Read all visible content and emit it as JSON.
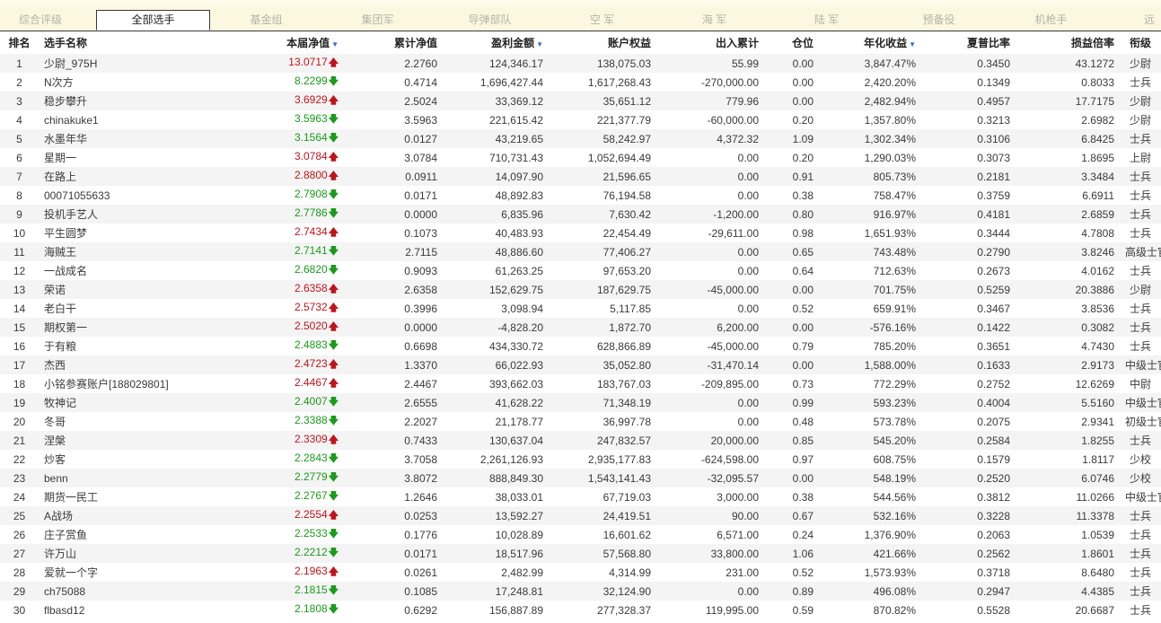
{
  "tabs": [
    {
      "label": "综合评级"
    },
    {
      "label": "全部选手"
    },
    {
      "label": "基金组"
    },
    {
      "label": "集团军"
    },
    {
      "label": "导弹部队"
    },
    {
      "label": "空 军"
    },
    {
      "label": "海 军"
    },
    {
      "label": "陆 军"
    },
    {
      "label": "预备役"
    },
    {
      "label": "机枪手"
    },
    {
      "label": "远"
    }
  ],
  "active_tab": "全部选手",
  "columns": {
    "rank": "排名",
    "name": "选手名称",
    "nav": "本届净值",
    "cum": "累计净值",
    "profit": "盈利金额",
    "equity": "账户权益",
    "inout": "出入累计",
    "pos": "仓位",
    "annual": "年化收益",
    "sharpe": "夏普比率",
    "ratio": "损益倍率",
    "title": "衔级"
  },
  "sort_indicator": "▼",
  "arrows": {
    "up": "🡅",
    "down": "🡇"
  },
  "colors": {
    "up": "#c0141d",
    "down": "#1b9a1b",
    "tab_bg": "#fcf8df",
    "row_alt": "#f4f4f4"
  },
  "rows": [
    {
      "rank": "1",
      "name": "少尉_975H",
      "nav": "13.0717",
      "dir": "up",
      "cum": "2.2760",
      "profit": "124,346.17",
      "equity": "138,075.03",
      "inout": "55.99",
      "pos": "0.00",
      "annual": "3,847.47%",
      "sharpe": "0.3450",
      "ratio": "43.1272",
      "title": "少尉"
    },
    {
      "rank": "2",
      "name": "N次方",
      "nav": "8.2299",
      "dir": "down",
      "cum": "0.4714",
      "profit": "1,696,427.44",
      "equity": "1,617,268.43",
      "inout": "-270,000.00",
      "pos": "0.00",
      "annual": "2,420.20%",
      "sharpe": "0.1349",
      "ratio": "0.8033",
      "title": "士兵"
    },
    {
      "rank": "3",
      "name": "稳步攀升",
      "nav": "3.6929",
      "dir": "up",
      "cum": "2.5024",
      "profit": "33,369.12",
      "equity": "35,651.12",
      "inout": "779.96",
      "pos": "0.00",
      "annual": "2,482.94%",
      "sharpe": "0.4957",
      "ratio": "17.7175",
      "title": "少尉"
    },
    {
      "rank": "4",
      "name": "chinakuke1",
      "nav": "3.5963",
      "dir": "down",
      "cum": "3.5963",
      "profit": "221,615.42",
      "equity": "221,377.79",
      "inout": "-60,000.00",
      "pos": "0.20",
      "annual": "1,357.80%",
      "sharpe": "0.3213",
      "ratio": "2.6982",
      "title": "少尉"
    },
    {
      "rank": "5",
      "name": "水墨年华",
      "nav": "3.1564",
      "dir": "down",
      "cum": "0.0127",
      "profit": "43,219.65",
      "equity": "58,242.97",
      "inout": "4,372.32",
      "pos": "1.09",
      "annual": "1,302.34%",
      "sharpe": "0.3106",
      "ratio": "6.8425",
      "title": "士兵"
    },
    {
      "rank": "6",
      "name": "星期一",
      "nav": "3.0784",
      "dir": "up",
      "cum": "3.0784",
      "profit": "710,731.43",
      "equity": "1,052,694.49",
      "inout": "0.00",
      "pos": "0.20",
      "annual": "1,290.03%",
      "sharpe": "0.3073",
      "ratio": "1.8695",
      "title": "上尉"
    },
    {
      "rank": "7",
      "name": "在路上",
      "nav": "2.8800",
      "dir": "up",
      "cum": "0.0911",
      "profit": "14,097.90",
      "equity": "21,596.65",
      "inout": "0.00",
      "pos": "0.91",
      "annual": "805.73%",
      "sharpe": "0.2181",
      "ratio": "3.3484",
      "title": "士兵"
    },
    {
      "rank": "8",
      "name": "00071055633",
      "nav": "2.7908",
      "dir": "down",
      "cum": "0.0171",
      "profit": "48,892.83",
      "equity": "76,194.58",
      "inout": "0.00",
      "pos": "0.38",
      "annual": "758.47%",
      "sharpe": "0.3759",
      "ratio": "6.6911",
      "title": "士兵"
    },
    {
      "rank": "9",
      "name": "投机手艺人",
      "nav": "2.7786",
      "dir": "down",
      "cum": "0.0000",
      "profit": "6,835.96",
      "equity": "7,630.42",
      "inout": "-1,200.00",
      "pos": "0.80",
      "annual": "916.97%",
      "sharpe": "0.4181",
      "ratio": "2.6859",
      "title": "士兵"
    },
    {
      "rank": "10",
      "name": "平生圆梦",
      "nav": "2.7434",
      "dir": "up",
      "cum": "0.1073",
      "profit": "40,483.93",
      "equity": "22,454.49",
      "inout": "-29,611.00",
      "pos": "0.98",
      "annual": "1,651.93%",
      "sharpe": "0.3444",
      "ratio": "4.7808",
      "title": "士兵"
    },
    {
      "rank": "11",
      "name": "海贼王",
      "nav": "2.7141",
      "dir": "down",
      "cum": "2.7115",
      "profit": "48,886.60",
      "equity": "77,406.27",
      "inout": "0.00",
      "pos": "0.65",
      "annual": "743.48%",
      "sharpe": "0.2790",
      "ratio": "3.8246",
      "title": "高级士官"
    },
    {
      "rank": "12",
      "name": "一战成名",
      "nav": "2.6820",
      "dir": "down",
      "cum": "0.9093",
      "profit": "61,263.25",
      "equity": "97,653.20",
      "inout": "0.00",
      "pos": "0.64",
      "annual": "712.63%",
      "sharpe": "0.2673",
      "ratio": "4.0162",
      "title": "士兵"
    },
    {
      "rank": "13",
      "name": "荣诺",
      "nav": "2.6358",
      "dir": "up",
      "cum": "2.6358",
      "profit": "152,629.75",
      "equity": "187,629.75",
      "inout": "-45,000.00",
      "pos": "0.00",
      "annual": "701.75%",
      "sharpe": "0.5259",
      "ratio": "20.3886",
      "title": "少尉"
    },
    {
      "rank": "14",
      "name": "老白干",
      "nav": "2.5732",
      "dir": "up",
      "cum": "0.3996",
      "profit": "3,098.94",
      "equity": "5,117.85",
      "inout": "0.00",
      "pos": "0.52",
      "annual": "659.91%",
      "sharpe": "0.3467",
      "ratio": "3.8536",
      "title": "士兵"
    },
    {
      "rank": "15",
      "name": "期权第一",
      "nav": "2.5020",
      "dir": "up",
      "cum": "0.0000",
      "profit": "-4,828.20",
      "equity": "1,872.70",
      "inout": "6,200.00",
      "pos": "0.00",
      "annual": "-576.16%",
      "sharpe": "0.1422",
      "ratio": "0.3082",
      "title": "士兵"
    },
    {
      "rank": "16",
      "name": "于有粮",
      "nav": "2.4883",
      "dir": "down",
      "cum": "0.6698",
      "profit": "434,330.72",
      "equity": "628,866.89",
      "inout": "-45,000.00",
      "pos": "0.79",
      "annual": "785.20%",
      "sharpe": "0.3651",
      "ratio": "4.7430",
      "title": "士兵"
    },
    {
      "rank": "17",
      "name": "杰西",
      "nav": "2.4723",
      "dir": "up",
      "cum": "1.3370",
      "profit": "66,022.93",
      "equity": "35,052.80",
      "inout": "-31,470.14",
      "pos": "0.00",
      "annual": "1,588.00%",
      "sharpe": "0.1633",
      "ratio": "2.9173",
      "title": "中级士官"
    },
    {
      "rank": "18",
      "name": "小铭参赛账户[188029801]",
      "nav": "2.4467",
      "dir": "up",
      "cum": "2.4467",
      "profit": "393,662.03",
      "equity": "183,767.03",
      "inout": "-209,895.00",
      "pos": "0.73",
      "annual": "772.29%",
      "sharpe": "0.2752",
      "ratio": "12.6269",
      "title": "中尉"
    },
    {
      "rank": "19",
      "name": "牧神记",
      "nav": "2.4007",
      "dir": "down",
      "cum": "2.6555",
      "profit": "41,628.22",
      "equity": "71,348.19",
      "inout": "0.00",
      "pos": "0.99",
      "annual": "593.23%",
      "sharpe": "0.4004",
      "ratio": "5.5160",
      "title": "中级士官"
    },
    {
      "rank": "20",
      "name": "冬哥",
      "nav": "2.3388",
      "dir": "down",
      "cum": "2.2027",
      "profit": "21,178.77",
      "equity": "36,997.78",
      "inout": "0.00",
      "pos": "0.48",
      "annual": "573.78%",
      "sharpe": "0.2075",
      "ratio": "2.9341",
      "title": "初级士官"
    },
    {
      "rank": "21",
      "name": "涅槃",
      "nav": "2.3309",
      "dir": "up",
      "cum": "0.7433",
      "profit": "130,637.04",
      "equity": "247,832.57",
      "inout": "20,000.00",
      "pos": "0.85",
      "annual": "545.20%",
      "sharpe": "0.2584",
      "ratio": "1.8255",
      "title": "士兵"
    },
    {
      "rank": "22",
      "name": "炒客",
      "nav": "2.2843",
      "dir": "down",
      "cum": "3.7058",
      "profit": "2,261,126.93",
      "equity": "2,935,177.83",
      "inout": "-624,598.00",
      "pos": "0.97",
      "annual": "608.75%",
      "sharpe": "0.1579",
      "ratio": "1.8117",
      "title": "少校"
    },
    {
      "rank": "23",
      "name": "benn",
      "nav": "2.2779",
      "dir": "down",
      "cum": "3.8072",
      "profit": "888,849.30",
      "equity": "1,543,141.43",
      "inout": "-32,095.57",
      "pos": "0.00",
      "annual": "548.19%",
      "sharpe": "0.2520",
      "ratio": "6.0746",
      "title": "少校"
    },
    {
      "rank": "24",
      "name": "期货一民工",
      "nav": "2.2767",
      "dir": "down",
      "cum": "1.2646",
      "profit": "38,033.01",
      "equity": "67,719.03",
      "inout": "3,000.00",
      "pos": "0.38",
      "annual": "544.56%",
      "sharpe": "0.3812",
      "ratio": "11.0266",
      "title": "中级士官"
    },
    {
      "rank": "25",
      "name": "A战场",
      "nav": "2.2554",
      "dir": "up",
      "cum": "0.0253",
      "profit": "13,592.27",
      "equity": "24,419.51",
      "inout": "90.00",
      "pos": "0.67",
      "annual": "532.16%",
      "sharpe": "0.3228",
      "ratio": "11.3378",
      "title": "士兵"
    },
    {
      "rank": "26",
      "name": "庄子赏鱼",
      "nav": "2.2533",
      "dir": "down",
      "cum": "0.1776",
      "profit": "10,028.89",
      "equity": "16,601.62",
      "inout": "6,571.00",
      "pos": "0.24",
      "annual": "1,376.90%",
      "sharpe": "0.2063",
      "ratio": "1.0539",
      "title": "士兵"
    },
    {
      "rank": "27",
      "name": "许万山",
      "nav": "2.2212",
      "dir": "down",
      "cum": "0.0171",
      "profit": "18,517.96",
      "equity": "57,568.80",
      "inout": "33,800.00",
      "pos": "1.06",
      "annual": "421.66%",
      "sharpe": "0.2562",
      "ratio": "1.8601",
      "title": "士兵"
    },
    {
      "rank": "28",
      "name": "爱就一个字",
      "nav": "2.1963",
      "dir": "up",
      "cum": "0.0261",
      "profit": "2,482.99",
      "equity": "4,314.99",
      "inout": "231.00",
      "pos": "0.52",
      "annual": "1,573.93%",
      "sharpe": "0.3718",
      "ratio": "8.6480",
      "title": "士兵"
    },
    {
      "rank": "29",
      "name": "ch75088",
      "nav": "2.1815",
      "dir": "down",
      "cum": "0.1085",
      "profit": "17,248.81",
      "equity": "32,124.90",
      "inout": "0.00",
      "pos": "0.89",
      "annual": "496.08%",
      "sharpe": "0.2947",
      "ratio": "4.4385",
      "title": "士兵"
    },
    {
      "rank": "30",
      "name": "flbasd12",
      "nav": "2.1808",
      "dir": "down",
      "cum": "0.6292",
      "profit": "156,887.89",
      "equity": "277,328.37",
      "inout": "119,995.00",
      "pos": "0.59",
      "annual": "870.82%",
      "sharpe": "0.5528",
      "ratio": "20.6687",
      "title": "士兵"
    }
  ]
}
